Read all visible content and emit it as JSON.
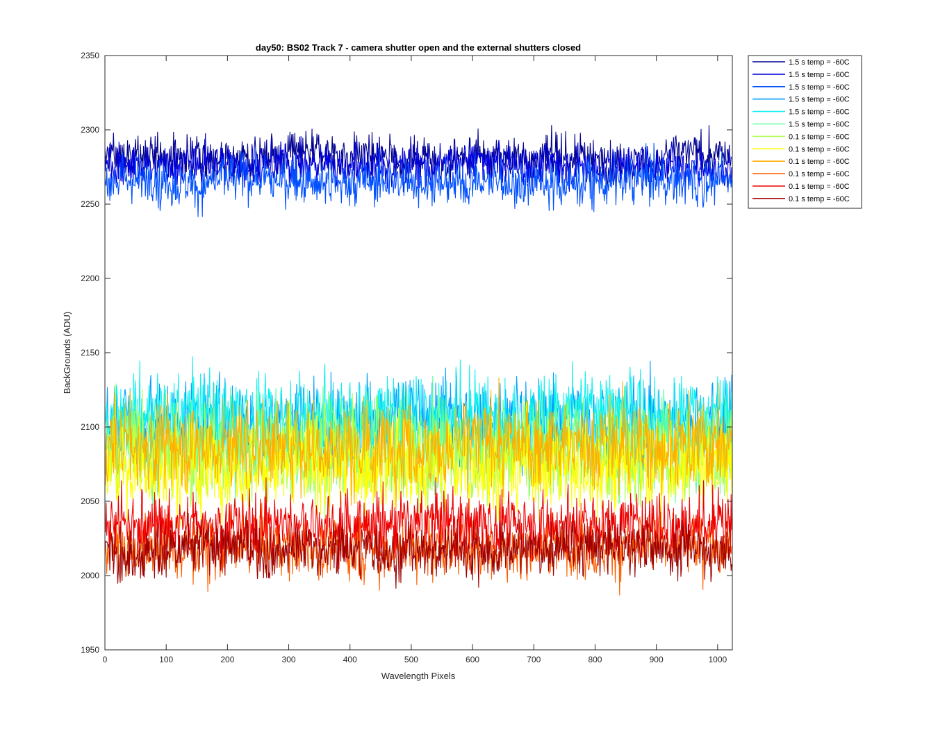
{
  "chart_data": {
    "type": "line",
    "title": "day50: BS02  Track 7 - camera shutter open and the external shutters closed",
    "xlabel": "Wavelength Pixels",
    "ylabel": "BackGrounds (ADU)",
    "xlim": [
      0,
      1024
    ],
    "ylim": [
      1950,
      2350
    ],
    "xticks": [
      0,
      100,
      200,
      300,
      400,
      500,
      600,
      700,
      800,
      900,
      1000
    ],
    "yticks": [
      1950,
      2000,
      2050,
      2100,
      2150,
      2200,
      2250,
      2300,
      2350
    ],
    "grid": false,
    "legend_position": "outside-top-right",
    "series": [
      {
        "name": "1.5 s temp = -60C",
        "color": "#00008F",
        "mean": 2282,
        "spread": 7,
        "peak": 2306,
        "low": 2262
      },
      {
        "name": "1.5 s temp = -60C",
        "color": "#0000DF",
        "mean": 2277,
        "spread": 7,
        "peak": 2300,
        "low": 2258
      },
      {
        "name": "1.5 s temp = -60C",
        "color": "#0050FF",
        "mean": 2266,
        "spread": 8,
        "peak": 2294,
        "low": 2236
      },
      {
        "name": "1.5 s temp = -60C",
        "color": "#00A0FF",
        "mean": 2105,
        "spread": 14,
        "peak": 2150,
        "low": 2065
      },
      {
        "name": "1.5 s temp = -60C",
        "color": "#10F0EF",
        "mean": 2108,
        "spread": 14,
        "peak": 2155,
        "low": 2070
      },
      {
        "name": "1.5 s temp = -60C",
        "color": "#60FF9F",
        "mean": 2092,
        "spread": 16,
        "peak": 2155,
        "low": 2040
      },
      {
        "name": "0.1 s temp = -60C",
        "color": "#AFFF50",
        "mean": 2080,
        "spread": 16,
        "peak": 2130,
        "low": 2035
      },
      {
        "name": "0.1 s temp = -60C",
        "color": "#FFFF00",
        "mean": 2075,
        "spread": 16,
        "peak": 2125,
        "low": 2030
      },
      {
        "name": "0.1 s temp = -60C",
        "color": "#FFAF00",
        "mean": 2088,
        "spread": 15,
        "peak": 2140,
        "low": 2040
      },
      {
        "name": "0.1 s temp = -60C",
        "color": "#FF6000",
        "mean": 2020,
        "spread": 10,
        "peak": 2060,
        "low": 1972
      },
      {
        "name": "0.1 s temp = -60C",
        "color": "#EF0000",
        "mean": 2035,
        "spread": 11,
        "peak": 2075,
        "low": 2000
      },
      {
        "name": "0.1 s temp = -60C",
        "color": "#9F0000",
        "mean": 2018,
        "spread": 9,
        "peak": 2055,
        "low": 1982
      }
    ]
  }
}
